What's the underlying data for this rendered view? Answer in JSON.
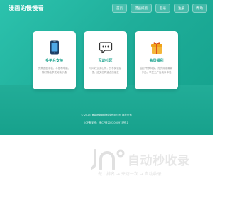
{
  "header": {
    "logo": "漫画的慢慢看",
    "nav": [
      "首页",
      "漫画排版",
      "登录",
      "注册",
      "帮助"
    ]
  },
  "cards": [
    {
      "icon": "phone-icon",
      "title": "多平台支持",
      "desc": "完美适配手机、平板和电脑，随时随地享受阅读乐趣"
    },
    {
      "icon": "chat-icon",
      "title": "互动社区",
      "desc": "与同好交流心得，分享阅读感想，结交志同道合的朋友"
    },
    {
      "icon": "gift-icon",
      "title": "会员福利",
      "desc": "会员专享特权，抢先阅读最新作品，享受无广告纯净体验"
    }
  ],
  "footer": {
    "copyright": "© 2023 海南虚数网络科技有限公司 版权所有",
    "icp": "ICP备案号：琼ICP备2022000978号-1"
  },
  "watermark": {
    "main": "自动秒收录",
    "sub": "做上排名 → 来访一次 → 自动收录"
  },
  "colors": {
    "primary": "#17a18c",
    "hero_start": "#2cc2ad",
    "hero_end": "#14a08b",
    "phone_icon": "#1e3f66",
    "gift_icon": "#f0a31a"
  }
}
